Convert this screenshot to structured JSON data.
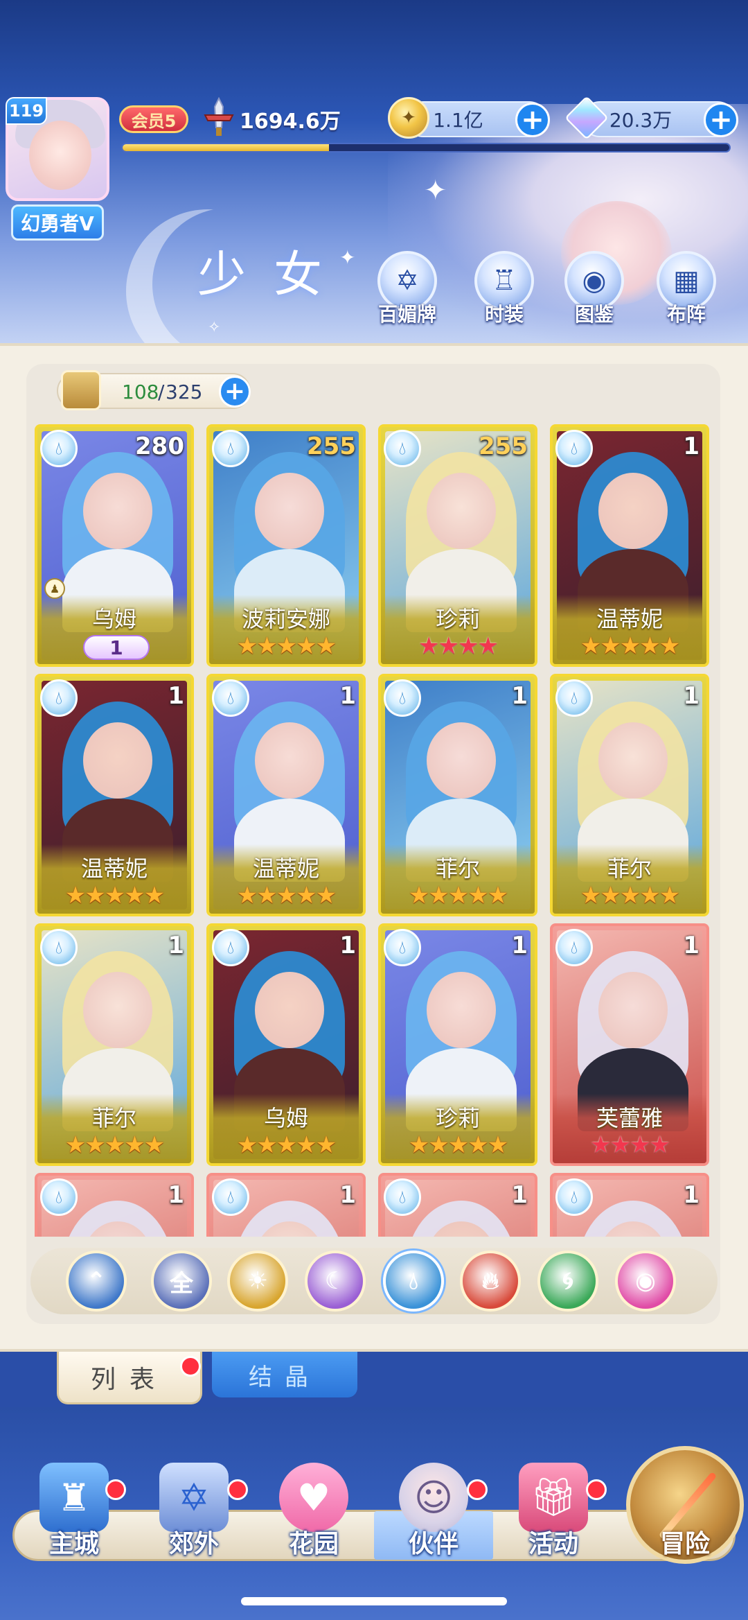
{
  "player": {
    "level": "119",
    "name": "幻勇者V",
    "vip": "会员5",
    "power": "1694.6万",
    "power_progress": 0.34
  },
  "currencies": {
    "gold": {
      "value": "1.1亿",
      "icon": "gold-coin-icon"
    },
    "gems": {
      "value": "20.3万",
      "icon": "crystal-gem-icon"
    }
  },
  "page_title": "少女",
  "top_buttons": [
    {
      "label": "百媚牌",
      "icon": "card-deck-icon"
    },
    {
      "label": "时装",
      "icon": "outfit-icon"
    },
    {
      "label": "图鉴",
      "icon": "codex-book-icon"
    },
    {
      "label": "布阵",
      "icon": "formation-grid-icon"
    }
  ],
  "capacity": {
    "current": "108",
    "max": "325"
  },
  "cards": [
    {
      "name": "乌姆",
      "count": "280",
      "rarity": "gold",
      "stars": "",
      "level_badge": "1",
      "element": "water"
    },
    {
      "name": "波莉安娜",
      "count": "255",
      "rarity": "gold",
      "stars": "★★★★★",
      "element": "water"
    },
    {
      "name": "珍莉",
      "count": "255",
      "rarity": "gold",
      "stars": "★★★★",
      "star_color": "red",
      "element": "water"
    },
    {
      "name": "温蒂妮",
      "count": "1",
      "rarity": "gold",
      "stars": "★★★★★",
      "element": "water"
    },
    {
      "name": "温蒂妮",
      "count": "1",
      "rarity": "gold",
      "stars": "★★★★★",
      "element": "water"
    },
    {
      "name": "温蒂妮",
      "count": "1",
      "rarity": "gold",
      "stars": "★★★★★",
      "element": "water"
    },
    {
      "name": "菲尔",
      "count": "1",
      "rarity": "gold",
      "stars": "★★★★★",
      "element": "water"
    },
    {
      "name": "菲尔",
      "count": "1",
      "rarity": "gold",
      "stars": "★★★★★",
      "element": "water"
    },
    {
      "name": "菲尔",
      "count": "1",
      "rarity": "gold",
      "stars": "★★★★★",
      "element": "water"
    },
    {
      "name": "乌姆",
      "count": "1",
      "rarity": "gold",
      "stars": "★★★★★",
      "element": "water"
    },
    {
      "name": "珍莉",
      "count": "1",
      "rarity": "gold",
      "stars": "★★★★★",
      "element": "water"
    },
    {
      "name": "芙蕾雅",
      "count": "1",
      "rarity": "red",
      "stars": "★★★★",
      "star_color": "red",
      "element": "water"
    },
    {
      "name": "",
      "count": "1",
      "rarity": "red",
      "stars": "",
      "element": "water"
    },
    {
      "name": "",
      "count": "1",
      "rarity": "red",
      "stars": "",
      "element": "water"
    },
    {
      "name": "",
      "count": "1",
      "rarity": "red",
      "stars": "",
      "element": "water"
    },
    {
      "name": "",
      "count": "1",
      "rarity": "red",
      "stars": "",
      "element": "water"
    }
  ],
  "filters": [
    {
      "icon": "star-up-icon",
      "label": "",
      "color": "#3f78c9"
    },
    {
      "icon": "all-filter-icon",
      "label": "全",
      "color": "#5a6fb8"
    },
    {
      "icon": "sun-element-icon",
      "label": "",
      "color": "#d8a52e"
    },
    {
      "icon": "moon-element-icon",
      "label": "",
      "color": "#9a5fd4"
    },
    {
      "icon": "water-element-icon",
      "label": "",
      "color": "#3a92d8"
    },
    {
      "icon": "fire-element-icon",
      "label": "",
      "color": "#d84a3a"
    },
    {
      "icon": "wind-element-icon",
      "label": "",
      "color": "#3aa858"
    },
    {
      "icon": "pink-element-icon",
      "label": "",
      "color": "#e04ba6"
    }
  ],
  "tabs": {
    "list": "列表",
    "crystal": "结晶"
  },
  "nav": [
    {
      "label": "主城",
      "icon": "castle-icon"
    },
    {
      "label": "郊外",
      "icon": "gate-icon"
    },
    {
      "label": "花园",
      "icon": "heart-garden-icon"
    },
    {
      "label": "伙伴",
      "icon": "partner-portrait-icon"
    },
    {
      "label": "活动",
      "icon": "gift-box-icon"
    },
    {
      "label": "冒险",
      "icon": "compass-icon"
    }
  ],
  "colors": {
    "accent_blue": "#2a8bf0",
    "gold_frame": "#f5d833",
    "red_frame": "#f78f87",
    "notice_red": "#ff2f3f"
  }
}
